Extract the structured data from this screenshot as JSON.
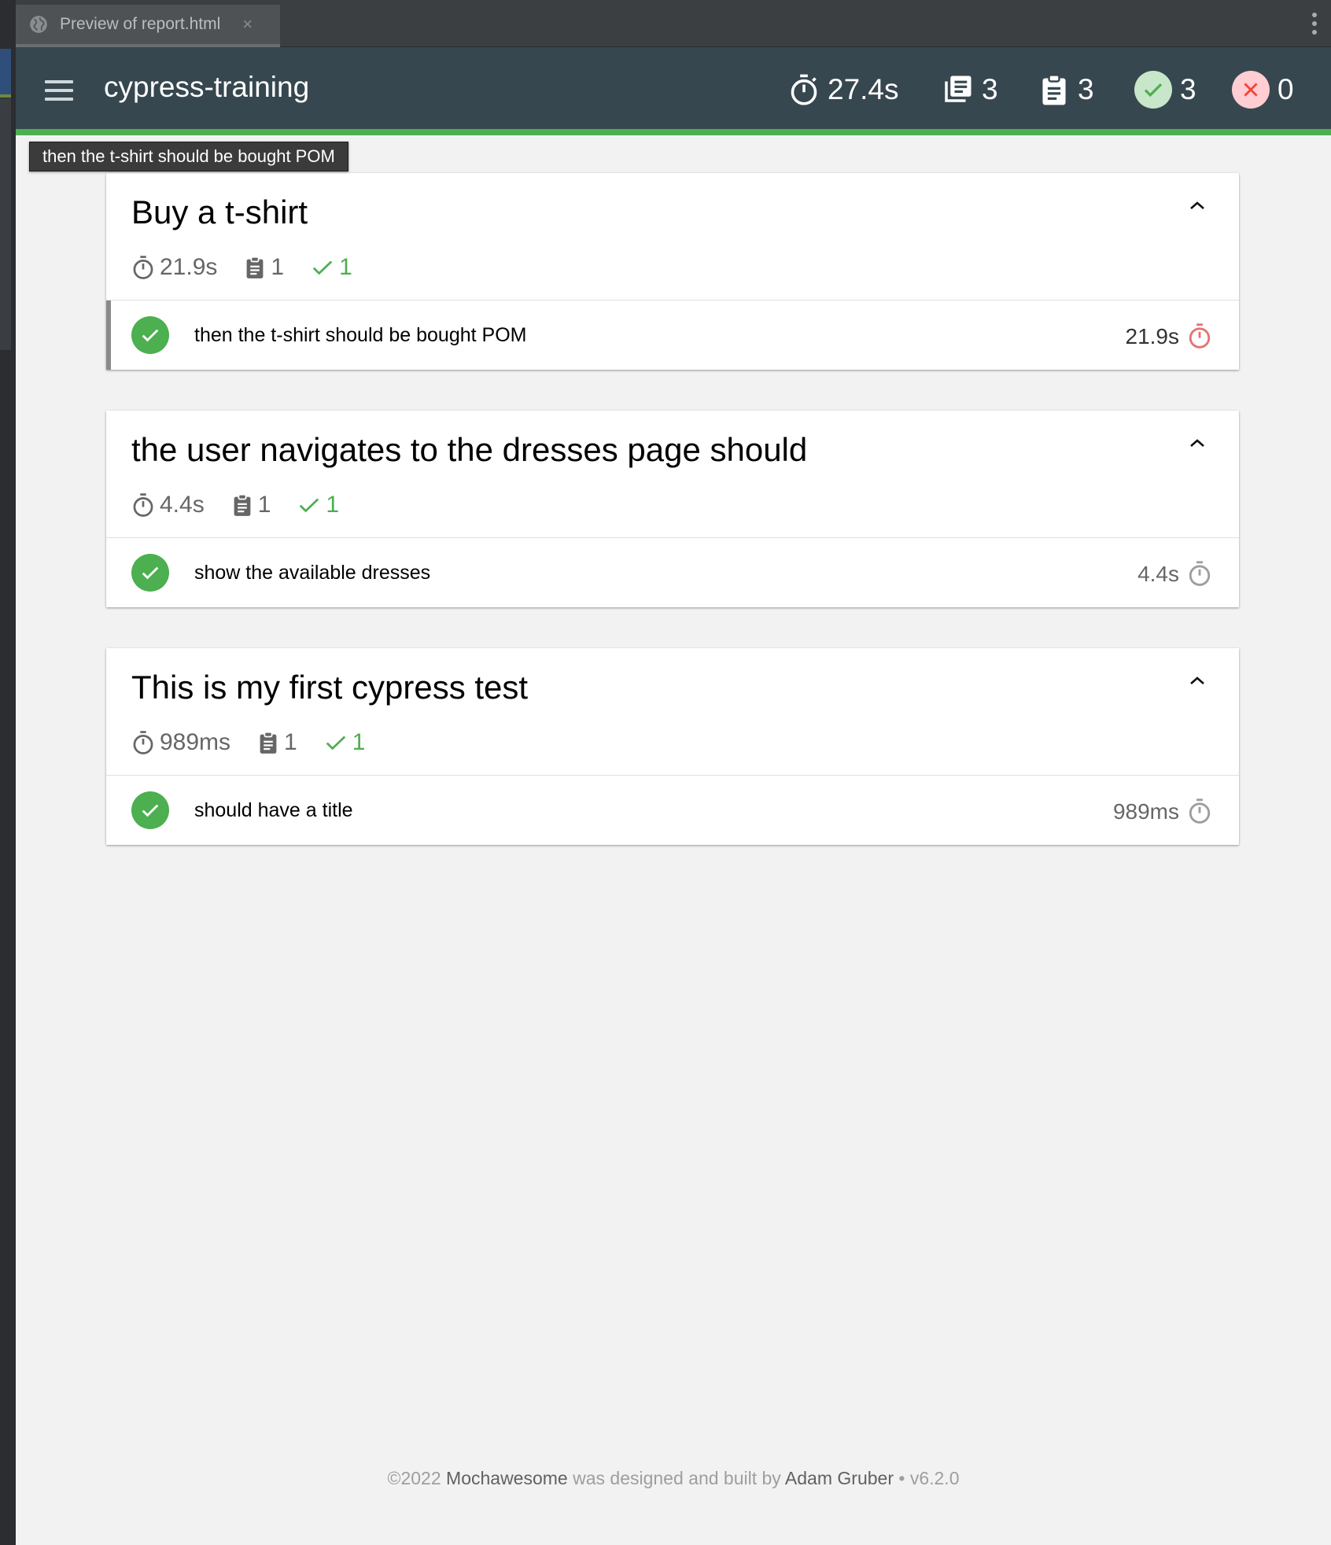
{
  "ide": {
    "tab_label": "Preview of report.html",
    "tab_close": "×"
  },
  "navbar": {
    "title": "cypress-training",
    "stats": {
      "duration": "27.4s",
      "suites": "3",
      "tests": "3",
      "passes": "3",
      "failures": "0"
    }
  },
  "tooltip": "then the t-shirt should be bought POM",
  "suites": [
    {
      "title": "Buy a t-shirt",
      "duration": "21.9s",
      "tests_count": "1",
      "passes_count": "1",
      "tests": [
        {
          "title": "then the t-shirt should be bought POM",
          "duration": "21.9s",
          "speed": "slow"
        }
      ]
    },
    {
      "title": "the user navigates to the dresses page should",
      "duration": "4.4s",
      "tests_count": "1",
      "passes_count": "1",
      "tests": [
        {
          "title": "show the available dresses",
          "duration": "4.4s",
          "speed": "medium"
        }
      ]
    },
    {
      "title": "This is my first cypress test",
      "duration": "989ms",
      "tests_count": "1",
      "passes_count": "1",
      "tests": [
        {
          "title": "should have a title",
          "duration": "989ms",
          "speed": "medium"
        }
      ]
    }
  ],
  "footer": {
    "copyright": "©2022",
    "product": "Mochawesome",
    "middle": "was designed and built by",
    "author": "Adam Gruber",
    "separator": "•",
    "version": "v6.2.0"
  },
  "colors": {
    "navbar_bg": "#37474f",
    "pass": "#4caf50",
    "fail": "#f44336",
    "slow_timer": "#e57373",
    "page_bg": "#f2f2f2"
  }
}
